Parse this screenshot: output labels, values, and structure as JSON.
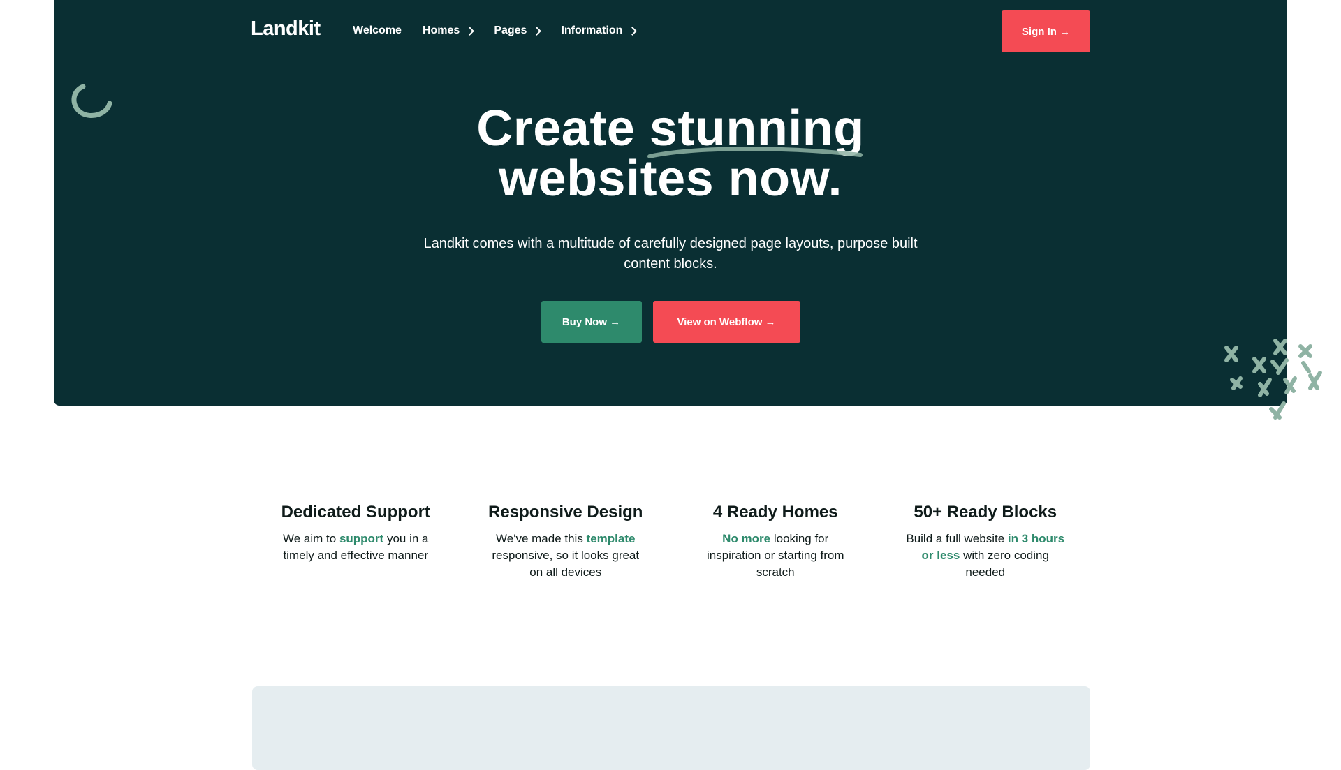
{
  "nav": {
    "logo": "Landkit",
    "links": [
      {
        "label": "Welcome",
        "has_chevron": false
      },
      {
        "label": "Homes",
        "has_chevron": true
      },
      {
        "label": "Pages",
        "has_chevron": true
      },
      {
        "label": "Information",
        "has_chevron": true
      }
    ],
    "signin_label": "Sign In →"
  },
  "hero": {
    "title_part1": "Create ",
    "title_highlight": "stunning",
    "title_line2": "websites now.",
    "subtitle": "Landkit comes with a multitude of carefully designed page layouts, purpose built content blocks.",
    "buy_label": "Buy Now →",
    "webflow_label": "View on Webflow →"
  },
  "features": [
    {
      "title": "Dedicated Support",
      "pre": "We aim to ",
      "highlight": "support",
      "post": " you in a timely and effective manner"
    },
    {
      "title": "Responsive Design",
      "pre": "We've made this ",
      "highlight": "template",
      "post": " responsive, so it looks great on all devices"
    },
    {
      "title": "4 Ready Homes",
      "pre": "",
      "highlight": "No more",
      "post": " looking for inspiration or starting from scratch"
    },
    {
      "title": "50+ Ready Blocks",
      "pre": "Build a full website ",
      "highlight": "in 3 hours or less",
      "post": " with zero coding needed"
    }
  ],
  "colors": {
    "hero_bg": "#0a2f33",
    "accent_red": "#f44b54",
    "accent_green": "#2e8a6c",
    "panel_bg": "#e5edf0"
  }
}
